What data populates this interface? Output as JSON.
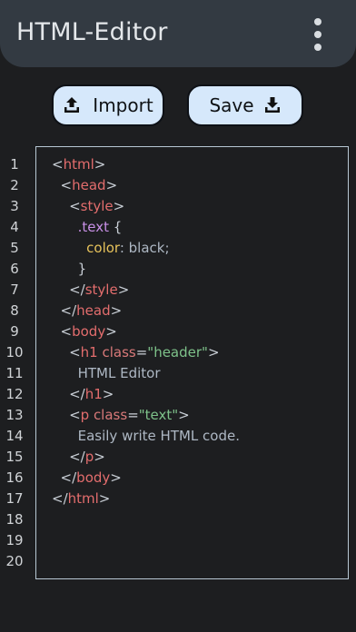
{
  "app": {
    "title": "HTML-Editor",
    "menu_icon": "more-vert-icon"
  },
  "toolbar": {
    "import_label": "Import",
    "import_icon": "upload-icon",
    "save_label": "Save",
    "save_icon": "download-icon"
  },
  "editor": {
    "line_numbers": [
      "1",
      "2",
      "3",
      "4",
      "5",
      "6",
      "7",
      "8",
      "9",
      "10",
      "11",
      "12",
      "13",
      "14",
      "15",
      "16",
      "17",
      "18",
      "19",
      "20"
    ],
    "lines": [
      [
        {
          "t": "<",
          "c": "punc"
        },
        {
          "t": "html",
          "c": "tag"
        },
        {
          "t": ">",
          "c": "punc"
        }
      ],
      [
        {
          "t": "  <",
          "c": "punc"
        },
        {
          "t": "head",
          "c": "tag"
        },
        {
          "t": ">",
          "c": "punc"
        }
      ],
      [
        {
          "t": "    <",
          "c": "punc"
        },
        {
          "t": "style",
          "c": "tag"
        },
        {
          "t": ">",
          "c": "punc"
        }
      ],
      [
        {
          "t": "      .text",
          "c": "sel"
        },
        {
          "t": " {",
          "c": "punc"
        }
      ],
      [
        {
          "t": "        color",
          "c": "prop"
        },
        {
          "t": ": black;",
          "c": "txt"
        }
      ],
      [
        {
          "t": "      }",
          "c": "punc"
        }
      ],
      [
        {
          "t": "    </",
          "c": "punc"
        },
        {
          "t": "style",
          "c": "tag"
        },
        {
          "t": ">",
          "c": "punc"
        }
      ],
      [
        {
          "t": "  </",
          "c": "punc"
        },
        {
          "t": "head",
          "c": "tag"
        },
        {
          "t": ">",
          "c": "punc"
        }
      ],
      [
        {
          "t": "  <",
          "c": "punc"
        },
        {
          "t": "body",
          "c": "tag"
        },
        {
          "t": ">",
          "c": "punc"
        }
      ],
      [
        {
          "t": "    <",
          "c": "punc"
        },
        {
          "t": "h1",
          "c": "tag"
        },
        {
          "t": " class",
          "c": "attr"
        },
        {
          "t": "=",
          "c": "punc"
        },
        {
          "t": "\"header\"",
          "c": "str"
        },
        {
          "t": ">",
          "c": "punc"
        }
      ],
      [
        {
          "t": "      HTML Editor",
          "c": "txt"
        }
      ],
      [
        {
          "t": "    </",
          "c": "punc"
        },
        {
          "t": "h1",
          "c": "tag"
        },
        {
          "t": ">",
          "c": "punc"
        }
      ],
      [
        {
          "t": "    <",
          "c": "punc"
        },
        {
          "t": "p",
          "c": "tag"
        },
        {
          "t": " class",
          "c": "attr"
        },
        {
          "t": "=",
          "c": "punc"
        },
        {
          "t": "\"text\"",
          "c": "str"
        },
        {
          "t": ">",
          "c": "punc"
        }
      ],
      [
        {
          "t": "      Easily write HTML code.",
          "c": "txt"
        }
      ],
      [
        {
          "t": "    </",
          "c": "punc"
        },
        {
          "t": "p",
          "c": "tag"
        },
        {
          "t": ">",
          "c": "punc"
        }
      ],
      [
        {
          "t": "  </",
          "c": "punc"
        },
        {
          "t": "body",
          "c": "tag"
        },
        {
          "t": ">",
          "c": "punc"
        }
      ],
      [
        {
          "t": "</",
          "c": "punc"
        },
        {
          "t": "html",
          "c": "tag"
        },
        {
          "t": ">",
          "c": "punc"
        }
      ],
      [],
      [],
      []
    ]
  }
}
